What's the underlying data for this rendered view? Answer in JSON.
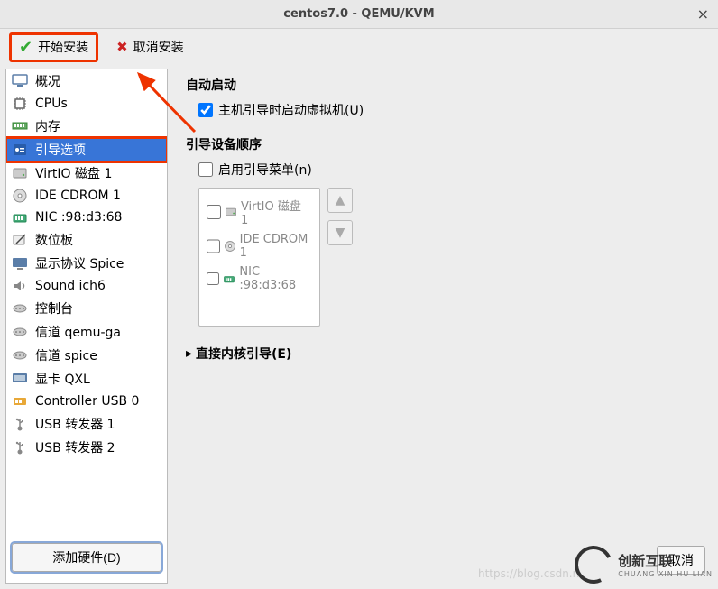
{
  "window": {
    "title": "centos7.0 - QEMU/KVM"
  },
  "toolbar": {
    "begin_install": "开始安装",
    "cancel_install": "取消安装"
  },
  "sidebar": {
    "items": [
      {
        "label": "概况",
        "icon": "monitor"
      },
      {
        "label": "CPUs",
        "icon": "cpu"
      },
      {
        "label": "内存",
        "icon": "ram"
      },
      {
        "label": "引导选项",
        "icon": "boot",
        "selected": true,
        "highlighted": true
      },
      {
        "label": "VirtIO 磁盘 1",
        "icon": "disk"
      },
      {
        "label": "IDE CDROM 1",
        "icon": "cdrom"
      },
      {
        "label": "NIC :98:d3:68",
        "icon": "nic"
      },
      {
        "label": "数位板",
        "icon": "tablet"
      },
      {
        "label": "显示协议 Spice",
        "icon": "display"
      },
      {
        "label": "Sound ich6",
        "icon": "sound"
      },
      {
        "label": "控制台",
        "icon": "serial"
      },
      {
        "label": "信道 qemu-ga",
        "icon": "serial"
      },
      {
        "label": "信道 spice",
        "icon": "serial"
      },
      {
        "label": "显卡 QXL",
        "icon": "video"
      },
      {
        "label": "Controller USB 0",
        "icon": "usbctrl"
      },
      {
        "label": "USB 转发器 1",
        "icon": "usb"
      },
      {
        "label": "USB 转发器 2",
        "icon": "usb"
      }
    ],
    "add_hardware": "添加硬件(D)"
  },
  "main": {
    "autostart_title": "自动启动",
    "autostart_checked": true,
    "autostart_label": "主机引导时启动虚拟机(U)",
    "bootorder_title": "引导设备顺序",
    "bootmenu_label": "启用引导菜单(n)",
    "boot_items": [
      {
        "label": "VirtIO 磁盘 1",
        "icon": "disk"
      },
      {
        "label": "IDE CDROM 1",
        "icon": "cdrom"
      },
      {
        "label": "NIC :98:d3:68",
        "icon": "nic"
      }
    ],
    "direct_kernel": "直接内核引导(E)",
    "cancel": "取消"
  },
  "watermark_text": "https://blog.csdn.n",
  "brand": {
    "name": "创新互联",
    "sub": "CHUANG XIN HU LIAN"
  }
}
